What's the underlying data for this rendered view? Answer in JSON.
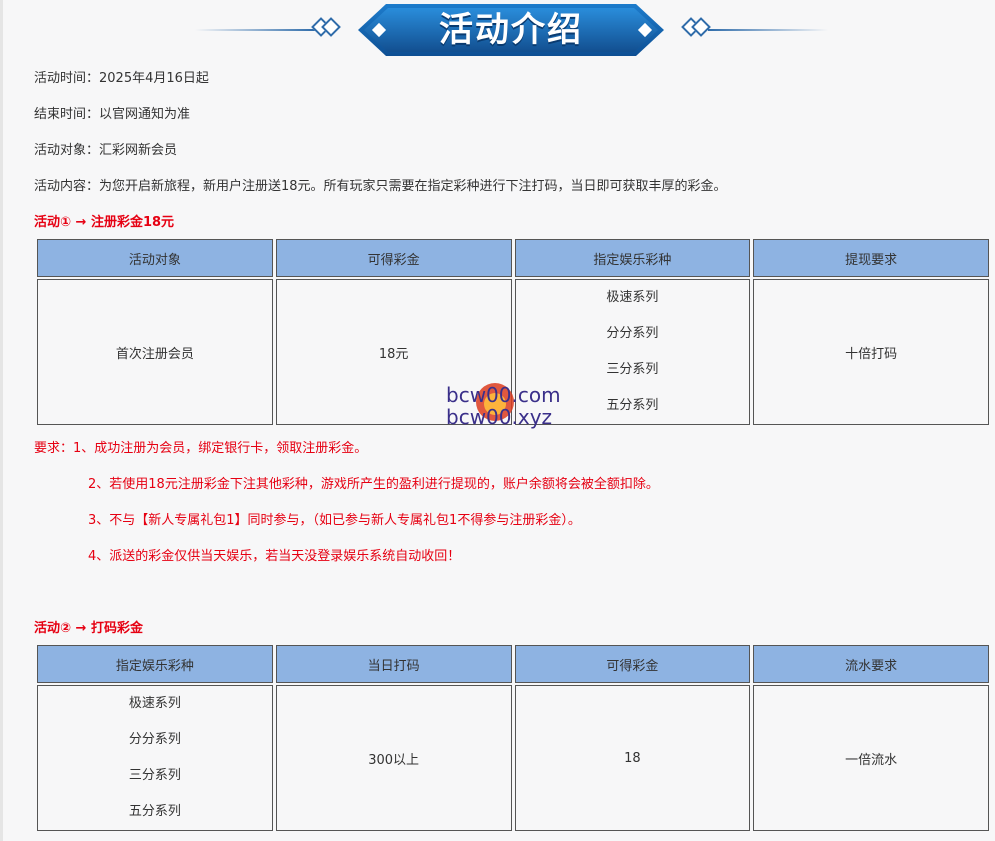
{
  "banner": {
    "title": "活动介绍"
  },
  "info": {
    "time": "活动时间：2025年4月16日起",
    "end": "结束时间：以官网通知为准",
    "target": "活动对象：汇彩网新会员",
    "content": "活动内容：为您开启新旅程，新用户注册送18元。所有玩家只需要在指定彩种进行下注打码，当日即可获取丰厚的彩金。"
  },
  "activity1": {
    "heading": "活动① → 注册彩金18元",
    "headers": [
      "活动对象",
      "可得彩金",
      "指定娱乐彩种",
      "提现要求"
    ],
    "row": {
      "target": "首次注册会员",
      "bonus": "18元",
      "series": [
        "极速系列",
        "分分系列",
        "三分系列",
        "五分系列"
      ],
      "withdraw": "十倍打码"
    }
  },
  "requirements": [
    "要求：1、成功注册为会员，绑定银行卡，领取注册彩金。",
    "2、若使用18元注册彩金下注其他彩种，游戏所产生的盈利进行提现的，账户余额将会被全额扣除。",
    "3、不与【新人专属礼包1】同时参与，（如已参与新人专属礼包1不得参与注册彩金）。",
    "4、派送的彩金仅供当天娱乐，若当天没登录娱乐系统自动收回！"
  ],
  "activity2": {
    "heading": "活动② → 打码彩金",
    "headers": [
      "指定娱乐彩种",
      "当日打码",
      "可得彩金",
      "流水要求"
    ],
    "row": {
      "series": [
        "极速系列",
        "分分系列",
        "三分系列",
        "五分系列"
      ],
      "betting": "300以上",
      "bonus": "18",
      "flow": "一倍流水"
    }
  },
  "watermark": {
    "line1": "bcw00.com",
    "line2": "bcw00.xyz"
  }
}
